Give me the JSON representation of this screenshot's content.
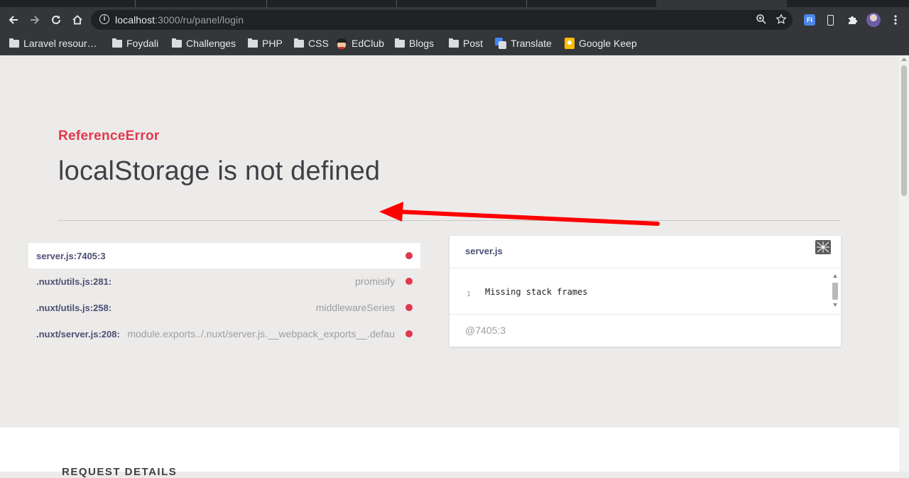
{
  "browser": {
    "url_host": "localhost",
    "url_path": ":3000/ru/panel/login",
    "bookmarks": [
      {
        "label": "Laravel resour…",
        "icon": "folder-icon"
      },
      {
        "label": "Foydali",
        "icon": "folder-icon"
      },
      {
        "label": "Challenges",
        "icon": "folder-icon"
      },
      {
        "label": "PHP",
        "icon": "folder-icon"
      },
      {
        "label": "CSS",
        "icon": "folder-icon"
      },
      {
        "label": "EdClub",
        "icon": "edclub-icon"
      },
      {
        "label": "Blogs",
        "icon": "folder-icon"
      },
      {
        "label": "Post",
        "icon": "folder-icon"
      },
      {
        "label": "Translate",
        "icon": "translate-icon"
      },
      {
        "label": "Google Keep",
        "icon": "google-keep-icon"
      }
    ],
    "extension_badge": "FI"
  },
  "error": {
    "type": "ReferenceError",
    "message": "localStorage is not defined"
  },
  "stack_frames": [
    {
      "location": "server.js:7405:3",
      "function": "",
      "selected": true
    },
    {
      "location": ".nuxt/utils.js:281:",
      "function": "promisify",
      "selected": false
    },
    {
      "location": ".nuxt/utils.js:258:",
      "function": "middlewareSeries",
      "selected": false
    },
    {
      "location": ".nuxt/server.js:208:",
      "function": "module.exports../.nuxt/server.js.__webpack_exports__.defau",
      "selected": false
    }
  ],
  "code_panel": {
    "file": "server.js",
    "line_number": "1",
    "code": "Missing stack frames",
    "position": "@7405:3"
  },
  "request_details": {
    "heading": "REQUEST DETAILS"
  },
  "colors": {
    "accent_red": "#e0384f",
    "frame_location": "#4c4f76",
    "annotation_arrow": "#ff0000"
  }
}
